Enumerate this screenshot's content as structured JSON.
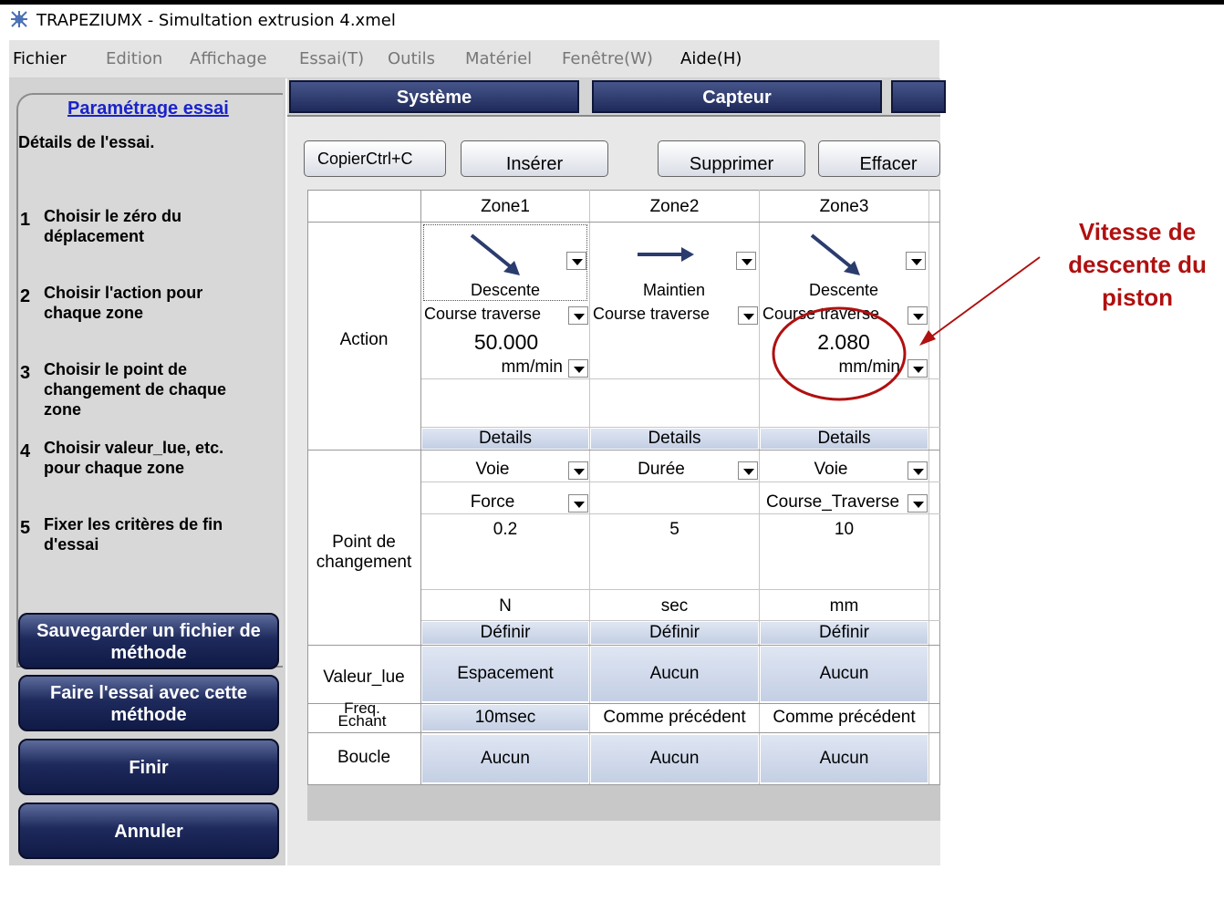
{
  "window": {
    "title": "TRAPEZIUMX  -  Simultation extrusion 4.xmel"
  },
  "menu": [
    "Fichier",
    "Edition",
    "Affichage",
    "Essai(T)",
    "Outils",
    "Matériel",
    "Fenêtre(W)",
    "Aide(H)"
  ],
  "left": {
    "header": "Paramétrage essai",
    "details": "Détails de l'essai.",
    "steps": [
      {
        "num": "1",
        "text": "Choisir le zéro du déplacement"
      },
      {
        "num": "2",
        "text": "Choisir l'action pour chaque zone"
      },
      {
        "num": "3",
        "text": "Choisir le point de changement de chaque zone"
      },
      {
        "num": "4",
        "text": "Choisir valeur_lue, etc. pour chaque zone"
      },
      {
        "num": "5",
        "text": "Fixer les critères de fin d'essai"
      }
    ],
    "buttons": [
      "Sauvegarder un fichier de méthode",
      "Faire l'essai avec cette méthode",
      "Finir",
      "Annuler"
    ]
  },
  "tabs": [
    "Système",
    "Capteur"
  ],
  "toolbar": {
    "copy": "CopierCtrl+C",
    "insert": "Insérer",
    "delete": "Supprimer",
    "clear": "Effacer"
  },
  "table": {
    "zones": [
      "Zone1",
      "Zone2",
      "Zone3"
    ],
    "row_labels": {
      "action": "Action",
      "point": "Point de changement",
      "valeur": "Valeur_lue",
      "freq": "Freq. Echant",
      "boucle": "Boucle"
    },
    "action_names": [
      "Descente",
      "Maintien",
      "Descente"
    ],
    "control": [
      "Course traverse",
      "Course traverse",
      "Course traverse"
    ],
    "speed": [
      "50.000",
      "",
      "2.080"
    ],
    "speed_unit": [
      "mm/min",
      "",
      "mm/min"
    ],
    "details": [
      "Details",
      "Details",
      "Details"
    ],
    "voie": [
      "Voie",
      "Durée",
      "Voie"
    ],
    "voie2": [
      "Force",
      "",
      "Course_Traverse"
    ],
    "point_val": [
      "0.2",
      "5",
      "10"
    ],
    "point_unit": [
      "N",
      "sec",
      "mm"
    ],
    "definir": [
      "Définir",
      "Définir",
      "Définir"
    ],
    "valeur": [
      "Espacement",
      "Aucun",
      "Aucun"
    ],
    "freq": [
      "10msec",
      "Comme précédent",
      "Comme précédent"
    ],
    "boucle": [
      "Aucun",
      "Aucun",
      "Aucun"
    ]
  },
  "annotation": "Vitesse de descente du piston"
}
